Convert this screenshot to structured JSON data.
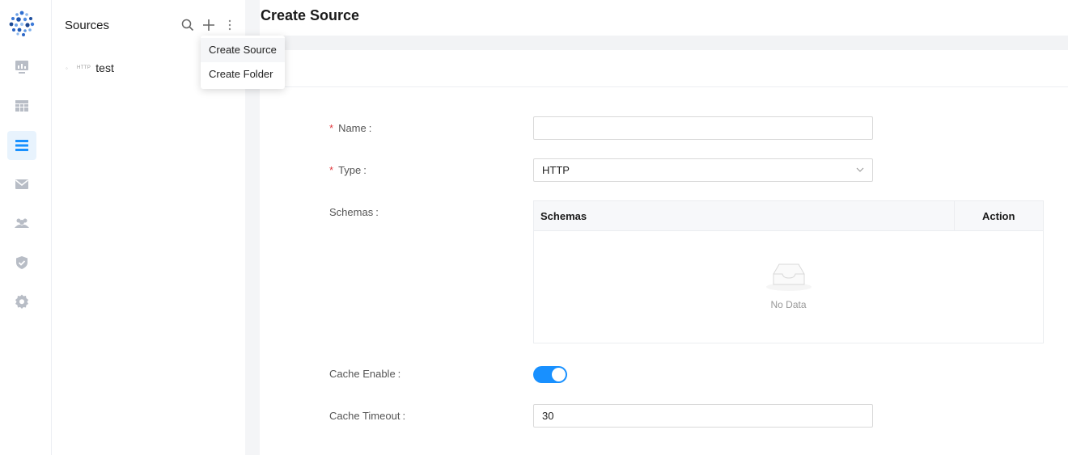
{
  "rail": {
    "items": [
      {
        "icon": "dashboard-icon"
      },
      {
        "icon": "table-icon"
      },
      {
        "icon": "sources-list-icon",
        "active": true
      },
      {
        "icon": "mail-icon"
      },
      {
        "icon": "users-icon"
      },
      {
        "icon": "shield-check-icon"
      },
      {
        "icon": "settings-gear-icon"
      }
    ],
    "accent": "#1890ff"
  },
  "panel": {
    "title": "Sources",
    "tree": [
      {
        "tag": "HTTP",
        "label": "test"
      }
    ]
  },
  "dropdown": {
    "items": [
      "Create Source",
      "Create Folder"
    ]
  },
  "main": {
    "title": "Create Source",
    "form": {
      "name_label": "Name",
      "name_value": "",
      "type_label": "Type",
      "type_value": "HTTP",
      "schemas_label": "Schemas",
      "table": {
        "columns": [
          "Schemas",
          "Action"
        ],
        "empty_text": "No Data"
      },
      "cache_enable_label": "Cache Enable",
      "cache_enable": true,
      "cache_timeout_label": "Cache Timeout",
      "cache_timeout_value": "30"
    }
  }
}
